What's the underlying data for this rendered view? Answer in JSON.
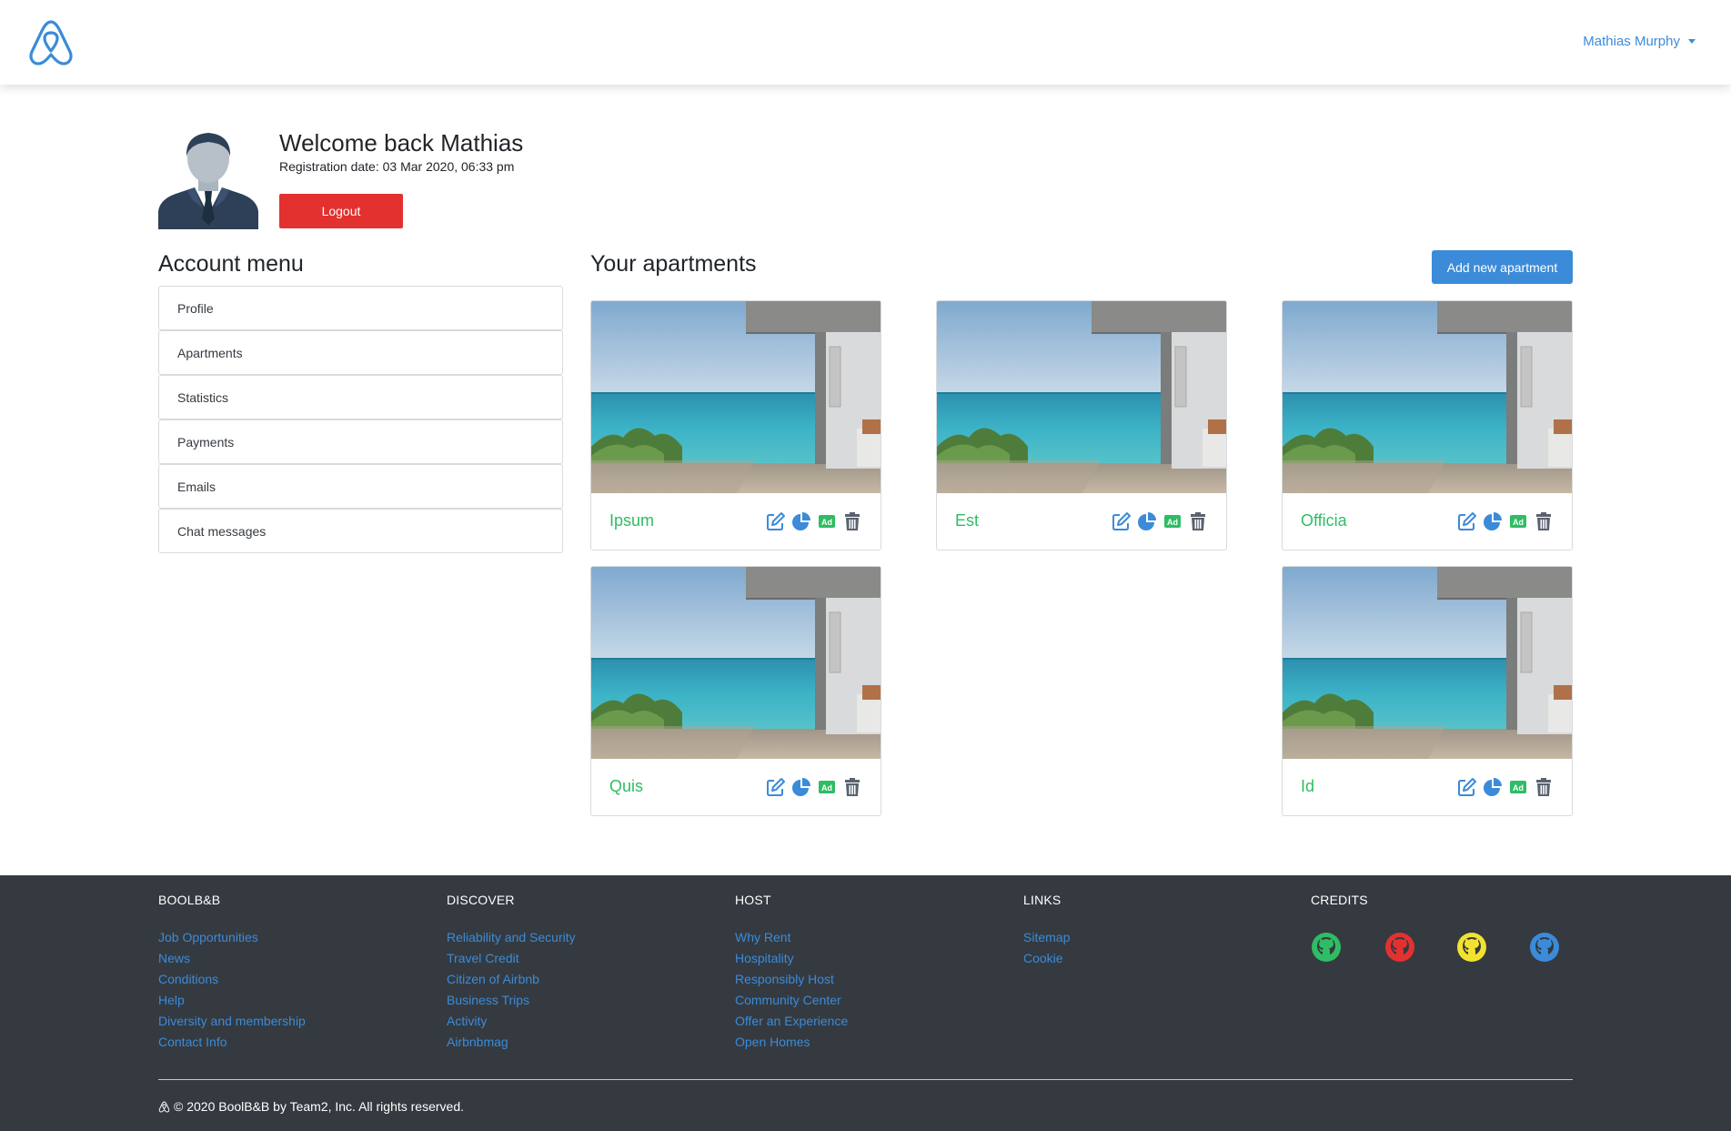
{
  "navbar": {
    "brand_icon": "airbnb-logo-icon",
    "user_name": "Mathias Murphy"
  },
  "profile": {
    "welcome": "Welcome back Mathias",
    "registration": "Registration date: 03 Mar 2020, 06:33 pm",
    "logout_label": "Logout"
  },
  "account_menu": {
    "title": "Account menu",
    "items": [
      "Profile",
      "Apartments",
      "Statistics",
      "Payments",
      "Emails",
      "Chat messages"
    ]
  },
  "apartments": {
    "title": "Your apartments",
    "add_label": "Add new apartment",
    "items": [
      {
        "name": "Ipsum"
      },
      {
        "name": "Est"
      },
      {
        "name": "Officia"
      },
      {
        "name": "Quis"
      },
      {
        "name": "Id"
      }
    ],
    "actions": [
      "edit-icon",
      "statistics-icon",
      "sponsor-ad-icon",
      "trash-icon"
    ]
  },
  "footer": {
    "columns": [
      {
        "title": "BOOLB&B",
        "links": [
          "Job Opportunities",
          "News",
          "Conditions",
          "Help",
          "Diversity and membership",
          "Contact Info"
        ]
      },
      {
        "title": "DISCOVER",
        "links": [
          "Reliability and Security",
          "Travel Credit",
          "Citizen of Airbnb",
          "Business Trips",
          "Activity",
          "Airbnbmag"
        ]
      },
      {
        "title": "HOST",
        "links": [
          "Why Rent",
          "Hospitality",
          "Responsibly Host",
          "Community Center",
          "Offer an Experience",
          "Open Homes"
        ]
      },
      {
        "title": "LINKS",
        "links": [
          "Sitemap",
          "Cookie"
        ]
      },
      {
        "title": "CREDITS",
        "links": []
      }
    ],
    "credit_icon_colors": [
      "#2ebd63",
      "#e3312f",
      "#f2e22e",
      "#3b8bd9"
    ],
    "copyright": "© 2020 BoolB&B by Team2, Inc. All rights reserved."
  },
  "colors": {
    "accent": "#3b8bd9",
    "green": "#2ebd63",
    "danger": "#e3312f",
    "footer_bg": "#343a40"
  }
}
